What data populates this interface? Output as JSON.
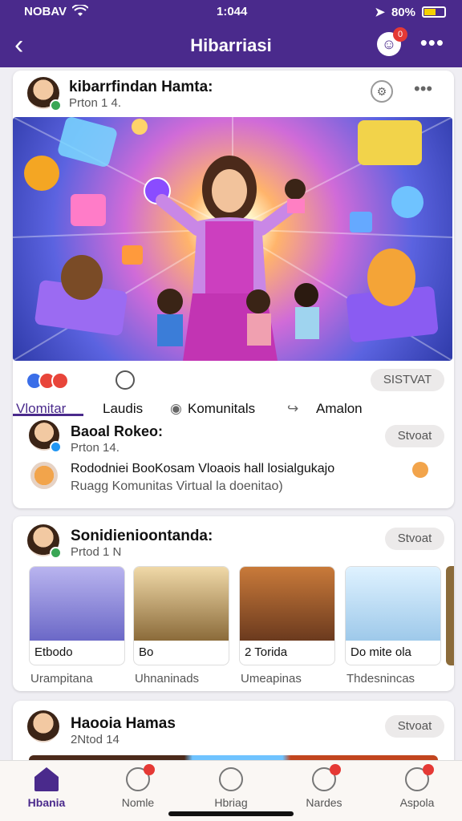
{
  "status": {
    "carrier": "NOBAV",
    "time": "1:044",
    "battery": "80%"
  },
  "header": {
    "title": "Hibarriasi",
    "notif_count": "0"
  },
  "post1": {
    "name": "kibarrfindan Hamta:",
    "meta": "Prton 1 4.",
    "reactions": [
      "Vlomitar",
      "Laudis",
      "Komunitals",
      "Amalon"
    ],
    "save_label": "SISTVAT"
  },
  "comment": {
    "name": "Baoal Rokeo:",
    "meta": "Prton 14.",
    "save_label": "Stvoat",
    "line1": "Rododniei BooKosam Vloaois hall losialgukajo",
    "line2": "Ruagg Komunitas Virtual la doenitao)"
  },
  "post2": {
    "name": "Sonidienioontanda:",
    "meta": "Prtod 1 N",
    "save_label": "Stvoat",
    "thumbs": [
      {
        "caption": "Etbodo",
        "sub": "Urampitana"
      },
      {
        "caption": "Bo",
        "sub": "Uhnaninads"
      },
      {
        "caption": "2 Torida",
        "sub": "Umeapinas"
      },
      {
        "caption": "Do mite ola",
        "sub": "Thdesnincas"
      }
    ]
  },
  "post3": {
    "name": "Haooia Hamas",
    "meta": "2Ntod 14",
    "save_label": "Stvoat"
  },
  "bottomnav": [
    {
      "label": "Hbania"
    },
    {
      "label": "Nomle"
    },
    {
      "label": "Hbriag"
    },
    {
      "label": "Nardes"
    },
    {
      "label": "Aspola"
    }
  ]
}
